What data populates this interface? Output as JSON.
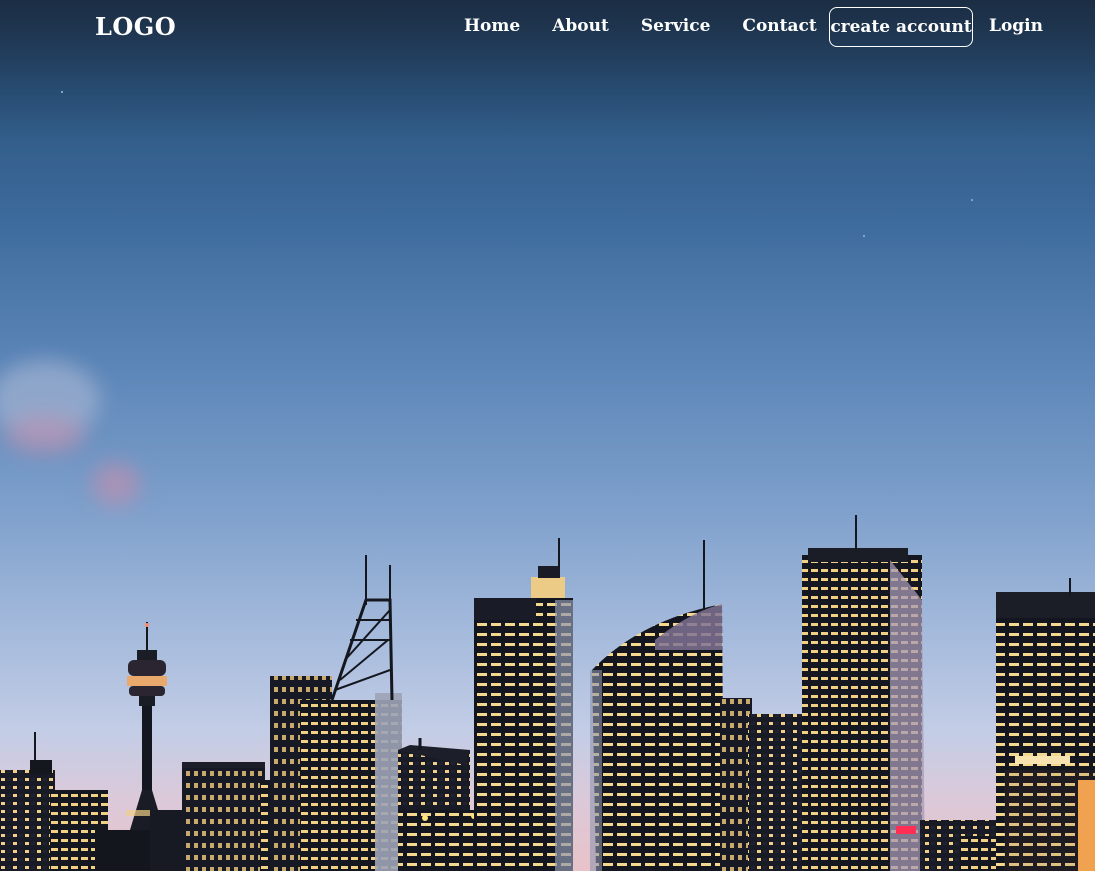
{
  "navbar": {
    "logo": "LOGO",
    "links": [
      {
        "label": "Home"
      },
      {
        "label": "About"
      },
      {
        "label": "Service"
      },
      {
        "label": "Contact"
      }
    ],
    "create_account_label": "create account",
    "login_label": "Login"
  },
  "hero": {
    "background_image": "city-skyline-at-dusk",
    "colors": {
      "sky_top": "#243d59",
      "sky_bottom": "#e8c3c8",
      "building": "#15171f",
      "window_light": "#f3d38a"
    }
  }
}
